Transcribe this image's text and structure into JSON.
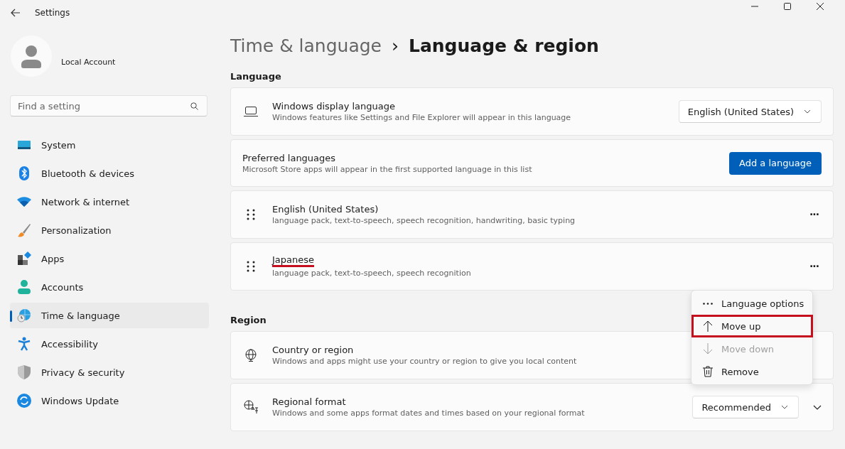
{
  "window": {
    "title": "Settings"
  },
  "account": {
    "name": "Local Account"
  },
  "search": {
    "placeholder": "Find a setting"
  },
  "sidebar": {
    "items": [
      {
        "label": "System",
        "kind": "system",
        "selected": false
      },
      {
        "label": "Bluetooth & devices",
        "kind": "bluetooth",
        "selected": false
      },
      {
        "label": "Network & internet",
        "kind": "network",
        "selected": false
      },
      {
        "label": "Personalization",
        "kind": "personalization",
        "selected": false
      },
      {
        "label": "Apps",
        "kind": "apps",
        "selected": false
      },
      {
        "label": "Accounts",
        "kind": "accounts",
        "selected": false
      },
      {
        "label": "Time & language",
        "kind": "time",
        "selected": true
      },
      {
        "label": "Accessibility",
        "kind": "accessibility",
        "selected": false
      },
      {
        "label": "Privacy & security",
        "kind": "privacy",
        "selected": false
      },
      {
        "label": "Windows Update",
        "kind": "update",
        "selected": false
      }
    ]
  },
  "breadcrumb": {
    "parent": "Time & language",
    "separator": "›",
    "current": "Language & region"
  },
  "language": {
    "heading": "Language",
    "display": {
      "title": "Windows display language",
      "description": "Windows features like Settings and File Explorer will appear in this language",
      "value": "English (United States)"
    },
    "preferred": {
      "title": "Preferred languages",
      "description": "Microsoft Store apps will appear in the first supported language in this list",
      "button": "Add a language"
    },
    "languages": [
      {
        "name": "English (United States)",
        "features": "language pack, text-to-speech, speech recognition, handwriting, basic typing",
        "underlined": false,
        "more": "···"
      },
      {
        "name": "Japanese",
        "features": "language pack, text-to-speech, speech recognition",
        "underlined": true,
        "more": "···"
      }
    ]
  },
  "menu": {
    "items": [
      {
        "label": "Language options",
        "kind": "options",
        "disabled": false,
        "highlighted": false
      },
      {
        "label": "Move up",
        "kind": "up",
        "disabled": false,
        "highlighted": true
      },
      {
        "label": "Move down",
        "kind": "down",
        "disabled": true,
        "highlighted": false
      },
      {
        "label": "Remove",
        "kind": "remove",
        "disabled": false,
        "highlighted": false
      }
    ]
  },
  "region": {
    "heading": "Region",
    "rows": [
      {
        "kind": "country",
        "title": "Country or region",
        "description": "Windows and apps might use your country or region to give you local content"
      },
      {
        "kind": "format",
        "title": "Regional format",
        "description": "Windows and some apps format dates and times based on your regional format",
        "value": "Recommended"
      }
    ]
  }
}
